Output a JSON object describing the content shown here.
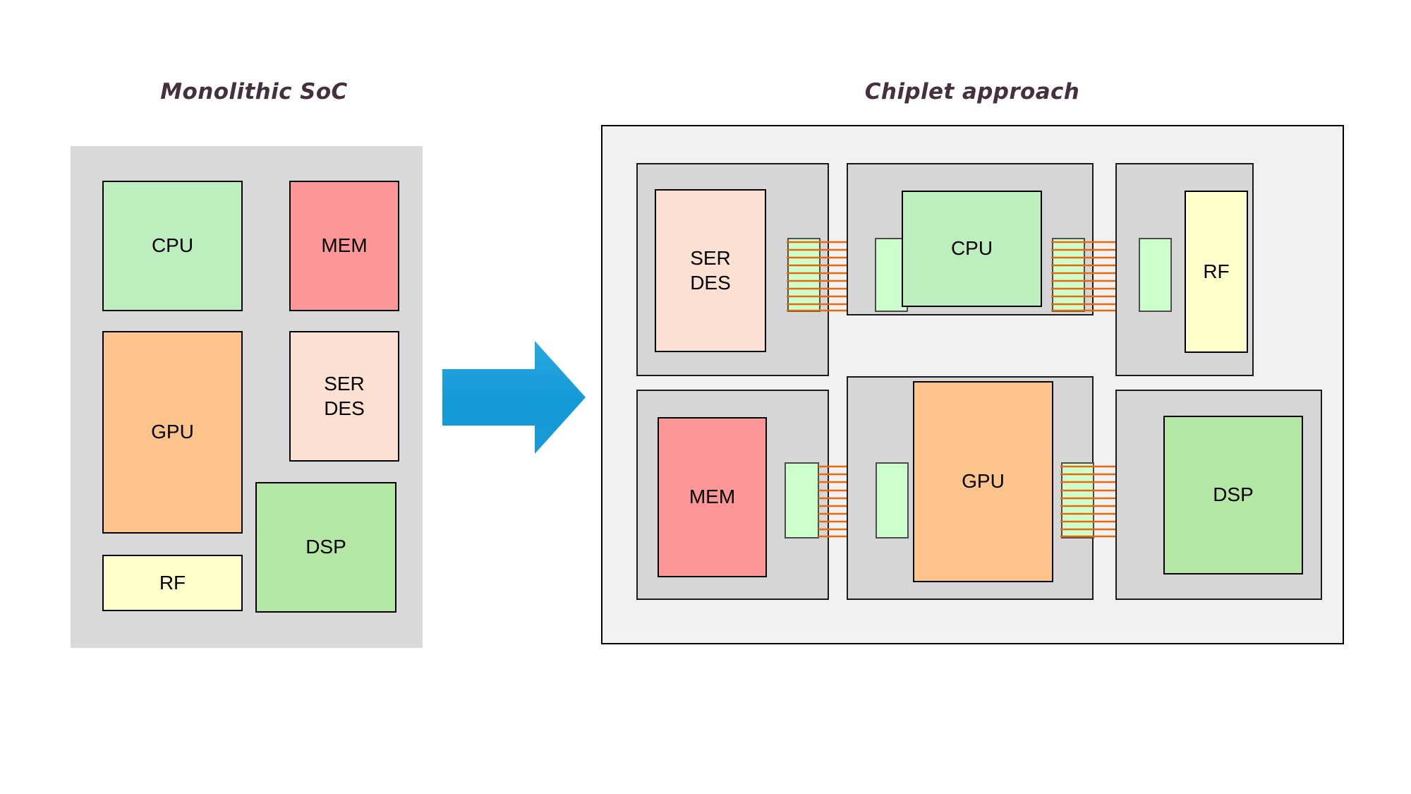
{
  "panels": {
    "left": {
      "title": "Monolithic SoC"
    },
    "right": {
      "title": "Chiplet approach"
    }
  },
  "colors": {
    "die_substrate": "#d9d9d9",
    "interposer": "#f1f1f1",
    "chiplet_package": "#d6d6d6",
    "pad": "#ccffcc",
    "wire": "#e8690b",
    "arrow": "#1b9ad6",
    "cpu": "#bdeebd",
    "mem": "#fd9696",
    "gpu": "#fcc38a",
    "serdes": "#fce0d2",
    "dsp": "#b4e6a4",
    "rf": "#ffffcc",
    "title_text": "#453040",
    "block_text": "#000000",
    "block_stroke": "#000000"
  },
  "monolithic": {
    "blocks": [
      {
        "id": "cpu",
        "label": "CPU",
        "fill": "#bdeebd"
      },
      {
        "id": "mem",
        "label": "MEM",
        "fill": "#fd9696"
      },
      {
        "id": "gpu",
        "label": "GPU",
        "fill": "#fcc38a"
      },
      {
        "id": "serdes",
        "label": "SER\nDES",
        "fill": "#fce0d2"
      },
      {
        "id": "rf",
        "label": "RF",
        "fill": "#ffffcc"
      },
      {
        "id": "dsp",
        "label": "DSP",
        "fill": "#b4e6a4"
      }
    ]
  },
  "chiplets": {
    "blocks": [
      {
        "id": "serdes",
        "label": "SER\nDES",
        "fill": "#fce0d2"
      },
      {
        "id": "cpu",
        "label": "CPU",
        "fill": "#bdeebd"
      },
      {
        "id": "rf",
        "label": "RF",
        "fill": "#ffffcc"
      },
      {
        "id": "mem",
        "label": "MEM",
        "fill": "#fd9696"
      },
      {
        "id": "gpu",
        "label": "GPU",
        "fill": "#fcc38a"
      },
      {
        "id": "dsp",
        "label": "DSP",
        "fill": "#b4e6a4"
      }
    ],
    "interconnects": [
      {
        "id": "serdes-cpu",
        "wire_count": 10
      },
      {
        "id": "cpu-rf",
        "wire_count": 10
      },
      {
        "id": "mem-gpu",
        "wire_count": 10
      },
      {
        "id": "gpu-dsp",
        "wire_count": 10
      }
    ]
  },
  "arrow": {
    "label": "transition-arrow",
    "direction": "right"
  }
}
